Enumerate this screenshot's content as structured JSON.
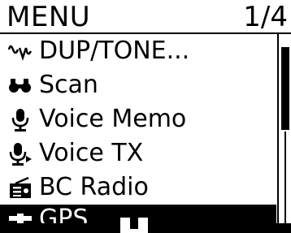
{
  "header": {
    "title": "MENU",
    "page": "1/4"
  },
  "menu": {
    "items": [
      {
        "label": "DUP/TONE...",
        "icon": "dup-tone-icon",
        "selected": false
      },
      {
        "label": "Scan",
        "icon": "binoculars-icon",
        "selected": false
      },
      {
        "label": "Voice Memo",
        "icon": "microphone-icon",
        "selected": false
      },
      {
        "label": "Voice TX",
        "icon": "microphone-tx-icon",
        "selected": false
      },
      {
        "label": "BC Radio",
        "icon": "radio-icon",
        "selected": false
      },
      {
        "label": "GPS",
        "icon": "satellite-icon",
        "selected": true
      }
    ]
  },
  "colors": {
    "background": "#ffffff",
    "foreground": "#000000",
    "selected_bg": "#000000",
    "selected_fg": "#ffffff"
  }
}
